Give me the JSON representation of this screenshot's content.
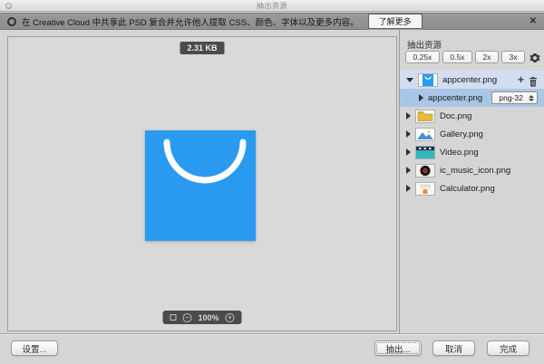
{
  "window": {
    "title": "抽出资源"
  },
  "notification": {
    "text": "在 Creative Cloud 中共享此 PSD 复合并允许他人提取 CSS、颜色、字体以及更多内容。",
    "learn_more_label": "了解更多"
  },
  "canvas": {
    "size_badge": "2.31 KB",
    "zoom_level": "100%"
  },
  "panel": {
    "title": "抽出资源",
    "scale_buttons": [
      "0.25x",
      "0.5x",
      "2x",
      "3x"
    ],
    "assets": [
      {
        "name": "appcenter.png",
        "selected": true,
        "expanded": true
      },
      {
        "name": "appcenter.png",
        "format": "png-32",
        "sub": true
      },
      {
        "name": "Doc.png"
      },
      {
        "name": "Gallery.png"
      },
      {
        "name": "Video.png"
      },
      {
        "name": "ic_music_icon.png"
      },
      {
        "name": "Calculator.png"
      }
    ]
  },
  "footer": {
    "settings_label": "设置...",
    "extract_label": "抽出...",
    "cancel_label": "取消",
    "done_label": "完成"
  },
  "icons": {
    "close": "✕",
    "add": "+",
    "zoom_in": "+",
    "zoom_out": "−"
  },
  "colors": {
    "app_icon_blue": "#2a9af0",
    "selected_row": "#d2ddef",
    "selected_subrow": "#a9c6e6",
    "banner_gray": "#919191"
  }
}
